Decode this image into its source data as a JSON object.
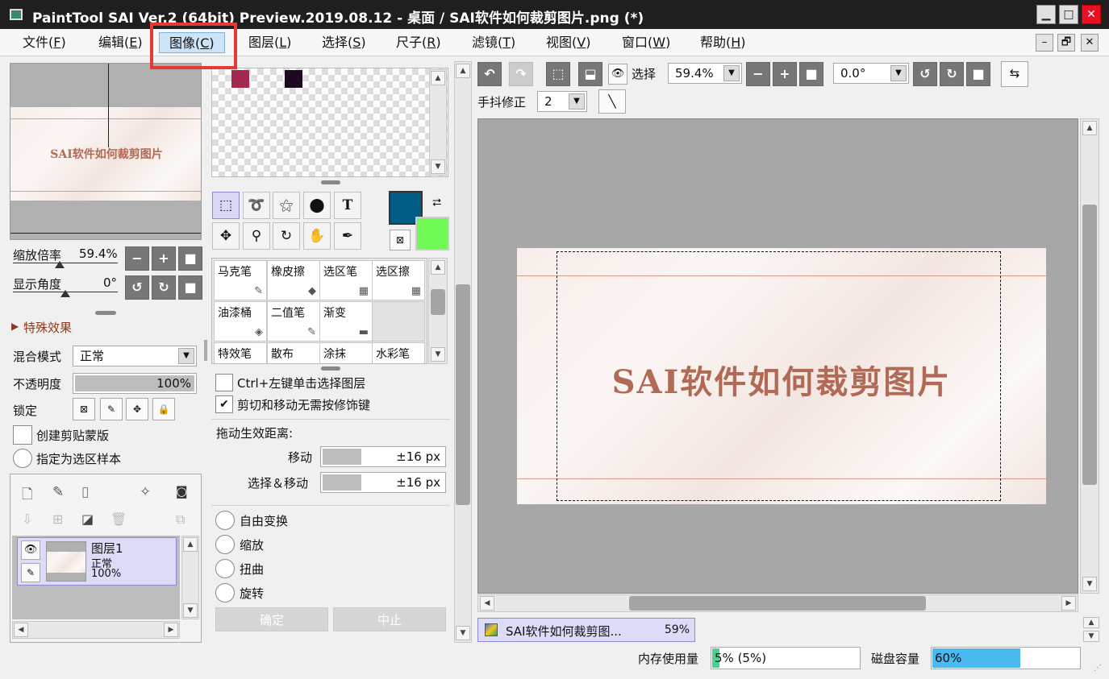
{
  "window": {
    "title": "PaintTool SAI Ver.2 (64bit) Preview.2019.08.12 - 桌面 / SAI软件如何裁剪图片.png (*)",
    "minimize": "▁",
    "maximize": "□",
    "close": "✕"
  },
  "menu": [
    {
      "label": "文件(",
      "key": "F",
      "end": ")"
    },
    {
      "label": "编辑(",
      "key": "E",
      "end": ")"
    },
    {
      "label": "图像(",
      "key": "C",
      "end": ")"
    },
    {
      "label": "图层(",
      "key": "L",
      "end": ")"
    },
    {
      "label": "选择(",
      "key": "S",
      "end": ")"
    },
    {
      "label": "尺子(",
      "key": "R",
      "end": ")"
    },
    {
      "label": "滤镜(",
      "key": "T",
      "end": ")"
    },
    {
      "label": "视图(",
      "key": "V",
      "end": ")"
    },
    {
      "label": "窗口(",
      "key": "W",
      "end": ")"
    },
    {
      "label": "帮助(",
      "key": "H",
      "end": ")"
    }
  ],
  "mdi": {
    "min": "–",
    "restore": "🗗",
    "close": "✕"
  },
  "navigator": {
    "preview_text": "SAI软件如何裁剪图片",
    "zoom_label": "缩放倍率",
    "zoom_value": "59.4%",
    "angle_label": "显示角度",
    "angle_value": "0°"
  },
  "layer_panel": {
    "fx_label": "特殊效果",
    "blend_label": "混合模式",
    "blend_value": "正常",
    "opacity_label": "不透明度",
    "opacity_value": "100%",
    "opacity_fraction": 1.0,
    "lock_label": "锁定",
    "clip_label": "创建剪贴蒙版",
    "sample_label": "指定为选区样本",
    "layers": [
      {
        "name": "图层1",
        "mode": "正常",
        "opacity": "100%"
      }
    ]
  },
  "swatches": [
    {
      "color": "#a3294f"
    },
    {
      "color": "#1c0a1f"
    }
  ],
  "colors": {
    "primary": "#005b85",
    "secondary": "#71fa55"
  },
  "brushes": [
    {
      "name": "马克笔",
      "icon": "✎"
    },
    {
      "name": "橡皮擦",
      "icon": "◆"
    },
    {
      "name": "选区笔",
      "icon": "▦"
    },
    {
      "name": "选区擦",
      "icon": "▦"
    },
    {
      "name": "油漆桶",
      "icon": "◈"
    },
    {
      "name": "二值笔",
      "icon": "✎"
    },
    {
      "name": "渐变",
      "icon": "▬"
    },
    {
      "name": "",
      "icon": ""
    },
    {
      "name": "特效笔",
      "icon": ""
    },
    {
      "name": "散布",
      "icon": ""
    },
    {
      "name": "涂抹",
      "icon": ""
    },
    {
      "name": "水彩笔",
      "icon": ""
    }
  ],
  "options": {
    "ctrl_click_label": "Ctrl+左键单击选择图层",
    "cut_move_label": "剪切和移动无需按修饰键",
    "drag_label": "拖动生效距离:",
    "move_label": "移动",
    "move_value": "±16 px",
    "move_fraction": 0.32,
    "selmove_label": "选择＆移动",
    "selmove_value": "±16 px",
    "selmove_fraction": 0.32,
    "free_transform": "自由变换",
    "scale": "缩放",
    "distort": "扭曲",
    "rotate": "旋转",
    "ok": "确定",
    "cancel": "中止"
  },
  "canvas_toolbar": {
    "select_label": "选择",
    "zoom_value": "59.4%",
    "angle_value": "0.0°",
    "stabilizer_label": "手抖修正",
    "stabilizer_value": "2"
  },
  "canvas": {
    "text": "SAI软件如何裁剪图片"
  },
  "document_tab": {
    "name": "SAI软件如何裁剪图...",
    "zoom": "59%"
  },
  "status": {
    "memory_label": "内存使用量",
    "memory_value": "5% (5%)",
    "memory_fraction": 0.05,
    "disk_label": "磁盘容量",
    "disk_value": "60%",
    "disk_fraction": 0.6
  }
}
